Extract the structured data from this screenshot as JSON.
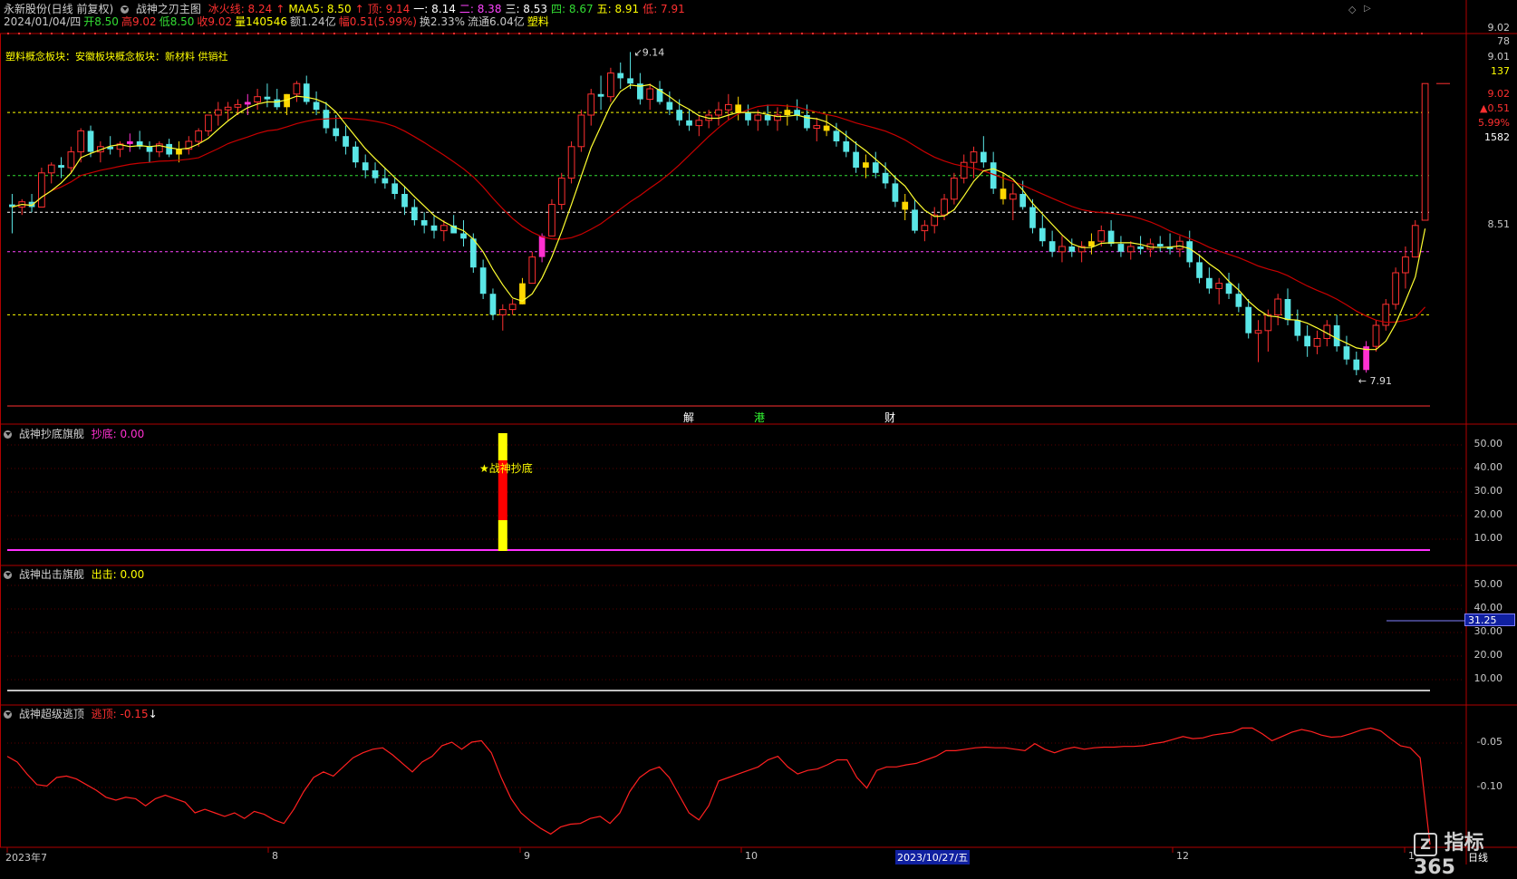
{
  "header": {
    "row1": {
      "stock": "永新股份(日线 前复权)",
      "indicator": "战神之刃主图",
      "items": [
        {
          "label": "冰火线: 8.24",
          "color": "#ff3030"
        },
        {
          "label": "↑",
          "color": "#ff3030"
        },
        {
          "label": "MAA5: 8.50",
          "color": "#ffff00"
        },
        {
          "label": "↑",
          "color": "#ff3030"
        },
        {
          "label": "顶: 9.14",
          "color": "#ff3030"
        },
        {
          "label": "一: 8.14",
          "color": "#ffffff"
        },
        {
          "label": "二: 8.38",
          "color": "#ff44ff"
        },
        {
          "label": "三: 8.53",
          "color": "#ffffff"
        },
        {
          "label": "四: 8.67",
          "color": "#33dd33"
        },
        {
          "label": "五: 8.91",
          "color": "#ffff00"
        },
        {
          "label": "低: 7.91",
          "color": "#ff3030"
        }
      ]
    },
    "row2": [
      {
        "label": "2024/01/04/四",
        "color": "#c8c8c8"
      },
      {
        "label": "开8.50",
        "color": "#33dd33"
      },
      {
        "label": "高9.02",
        "color": "#ff3030"
      },
      {
        "label": "低8.50",
        "color": "#33dd33"
      },
      {
        "label": "收9.02",
        "color": "#ff3030"
      },
      {
        "label": "量140546",
        "color": "#ffff00"
      },
      {
        "label": "额1.24亿",
        "color": "#c8c8c8"
      },
      {
        "label": "幅0.51(5.99%)",
        "color": "#ff3030"
      },
      {
        "label": "换2.33%",
        "color": "#c8c8c8"
      },
      {
        "label": "流通6.04亿",
        "color": "#c8c8c8"
      },
      {
        "label": "塑料",
        "color": "#ffff00"
      }
    ],
    "concept": "塑料概念板块：安徽板块概念板块：新材料 供销社"
  },
  "main_chart": {
    "price_axis": {
      "top": "9.02",
      "top2": "78",
      "p1": "9.01",
      "p1b": "137",
      "p2": "9.02",
      "p3": "▲0.51",
      "p4": "5.99%",
      "p5": "1582",
      "p6": "8.51"
    },
    "high_mark": "9.14",
    "low_mark": "7.91",
    "events": [
      "解",
      "港",
      "财"
    ],
    "ylim": [
      7.8,
      9.2
    ]
  },
  "panel1": {
    "title": "战神抄底旗舰",
    "value_label": "抄底: 0.00",
    "signal_text": "★战神抄底",
    "ticks": [
      "50.00",
      "40.00",
      "30.00",
      "20.00",
      "10.00"
    ]
  },
  "panel2": {
    "title": "战神出击旗舰",
    "value_label": "出击: 0.00",
    "cursor_value": "31.25",
    "ticks": [
      "50.00",
      "40.00",
      "30.00",
      "20.00",
      "10.00"
    ]
  },
  "panel3": {
    "title": "战神超级逃顶",
    "value_label": "逃顶: -0.15",
    "arrow": "↓",
    "ticks": [
      "-0.05",
      "-0.10"
    ],
    "ylim": [
      -0.2,
      0.0
    ],
    "values": [
      -0.07,
      -0.078,
      -0.095,
      -0.11,
      -0.112,
      -0.1,
      -0.098,
      -0.102,
      -0.11,
      -0.118,
      -0.128,
      -0.132,
      -0.128,
      -0.13,
      -0.14,
      -0.13,
      -0.125,
      -0.13,
      -0.135,
      -0.15,
      -0.145,
      -0.15,
      -0.155,
      -0.15,
      -0.158,
      -0.148,
      -0.152,
      -0.16,
      -0.165,
      -0.145,
      -0.12,
      -0.1,
      -0.092,
      -0.098,
      -0.085,
      -0.072,
      -0.065,
      -0.06,
      -0.058,
      -0.068,
      -0.08,
      -0.092,
      -0.078,
      -0.07,
      -0.055,
      -0.05,
      -0.06,
      -0.05,
      -0.048,
      -0.065,
      -0.1,
      -0.13,
      -0.15,
      -0.162,
      -0.172,
      -0.18,
      -0.17,
      -0.166,
      -0.165,
      -0.158,
      -0.155,
      -0.165,
      -0.15,
      -0.12,
      -0.1,
      -0.09,
      -0.085,
      -0.1,
      -0.125,
      -0.15,
      -0.16,
      -0.14,
      -0.105,
      -0.1,
      -0.095,
      -0.09,
      -0.085,
      -0.075,
      -0.07,
      -0.085,
      -0.095,
      -0.09,
      -0.088,
      -0.082,
      -0.075,
      -0.075,
      -0.1,
      -0.115,
      -0.09,
      -0.085,
      -0.085,
      -0.082,
      -0.08,
      -0.075,
      -0.07,
      -0.062,
      -0.062,
      -0.06,
      -0.058,
      -0.057,
      -0.058,
      -0.058,
      -0.06,
      -0.062,
      -0.052,
      -0.06,
      -0.065,
      -0.06,
      -0.057,
      -0.06,
      -0.058,
      -0.057,
      -0.057,
      -0.056,
      -0.056,
      -0.055,
      -0.052,
      -0.05,
      -0.046,
      -0.042,
      -0.045,
      -0.044,
      -0.04,
      -0.038,
      -0.036,
      -0.03,
      -0.03,
      -0.038,
      -0.048,
      -0.042,
      -0.036,
      -0.032,
      -0.035,
      -0.04,
      -0.043,
      -0.042,
      -0.038,
      -0.033,
      -0.03,
      -0.034,
      -0.045,
      -0.055,
      -0.058,
      -0.072,
      -0.195
    ]
  },
  "xaxis": {
    "labels": [
      "2023年7",
      "8",
      "9",
      "10",
      "2023/10/27/五",
      "12",
      "1"
    ],
    "right_label": "日线"
  },
  "watermark": {
    "text": "指标365",
    "logo": "Z"
  },
  "colors": {
    "up": "#ff3030",
    "down": "#5ae6e6",
    "yellowbar": "#ffd800",
    "magenta": "#ff30d0",
    "ma5": "#ffff30",
    "ma_long": "#c80000",
    "border": "#b00000"
  },
  "candles": [
    [
      8.56,
      8.6,
      8.45,
      8.55
    ],
    [
      8.55,
      8.58,
      8.52,
      8.57
    ],
    [
      8.57,
      8.6,
      8.53,
      8.55
    ],
    [
      8.55,
      8.7,
      8.55,
      8.68
    ],
    [
      8.68,
      8.72,
      8.64,
      8.71
    ],
    [
      8.71,
      8.74,
      8.66,
      8.7
    ],
    [
      8.7,
      8.78,
      8.68,
      8.76
    ],
    [
      8.76,
      8.85,
      8.72,
      8.84
    ],
    [
      8.84,
      8.86,
      8.74,
      8.76
    ],
    [
      8.76,
      8.8,
      8.72,
      8.78
    ],
    [
      8.78,
      8.82,
      8.75,
      8.77
    ],
    [
      8.77,
      8.8,
      8.74,
      8.79
    ],
    [
      8.79,
      8.83,
      8.76,
      8.8
    ],
    [
      8.8,
      8.84,
      8.77,
      8.78
    ],
    [
      8.78,
      8.8,
      8.72,
      8.76
    ],
    [
      8.76,
      8.8,
      8.74,
      8.79
    ],
    [
      8.79,
      8.81,
      8.74,
      8.75
    ],
    [
      8.75,
      8.8,
      8.72,
      8.77
    ],
    [
      8.77,
      8.82,
      8.75,
      8.8
    ],
    [
      8.8,
      8.85,
      8.78,
      8.84
    ],
    [
      8.84,
      8.9,
      8.82,
      8.9
    ],
    [
      8.9,
      8.95,
      8.86,
      8.92
    ],
    [
      8.92,
      8.95,
      8.88,
      8.93
    ],
    [
      8.93,
      8.96,
      8.9,
      8.94
    ],
    [
      8.94,
      8.98,
      8.9,
      8.95
    ],
    [
      8.95,
      9.0,
      8.92,
      8.97
    ],
    [
      8.97,
      9.02,
      8.93,
      8.96
    ],
    [
      8.96,
      9.0,
      8.92,
      8.93
    ],
    [
      8.93,
      8.98,
      8.9,
      8.98
    ],
    [
      8.98,
      9.03,
      8.95,
      9.02
    ],
    [
      9.02,
      9.05,
      8.94,
      8.95
    ],
    [
      8.95,
      8.99,
      8.9,
      8.92
    ],
    [
      8.92,
      8.95,
      8.83,
      8.85
    ],
    [
      8.85,
      8.9,
      8.8,
      8.82
    ],
    [
      8.82,
      8.86,
      8.75,
      8.78
    ],
    [
      8.78,
      8.8,
      8.7,
      8.72
    ],
    [
      8.72,
      8.75,
      8.66,
      8.69
    ],
    [
      8.69,
      8.72,
      8.64,
      8.66
    ],
    [
      8.66,
      8.7,
      8.62,
      8.64
    ],
    [
      8.64,
      8.66,
      8.58,
      8.6
    ],
    [
      8.6,
      8.63,
      8.52,
      8.55
    ],
    [
      8.55,
      8.58,
      8.48,
      8.5
    ],
    [
      8.5,
      8.53,
      8.45,
      8.48
    ],
    [
      8.48,
      8.52,
      8.43,
      8.46
    ],
    [
      8.46,
      8.5,
      8.42,
      8.48
    ],
    [
      8.48,
      8.52,
      8.45,
      8.45
    ],
    [
      8.45,
      8.5,
      8.4,
      8.43
    ],
    [
      8.43,
      8.45,
      8.3,
      8.32
    ],
    [
      8.32,
      8.35,
      8.2,
      8.22
    ],
    [
      8.22,
      8.24,
      8.12,
      8.14
    ],
    [
      8.14,
      8.18,
      8.08,
      8.16
    ],
    [
      8.16,
      8.2,
      8.14,
      8.18
    ],
    [
      8.18,
      8.28,
      8.18,
      8.26
    ],
    [
      8.26,
      8.38,
      8.26,
      8.36
    ],
    [
      8.36,
      8.45,
      8.34,
      8.44
    ],
    [
      8.44,
      8.58,
      8.44,
      8.56
    ],
    [
      8.56,
      8.68,
      8.54,
      8.66
    ],
    [
      8.66,
      8.8,
      8.64,
      8.78
    ],
    [
      8.78,
      8.92,
      8.76,
      8.9
    ],
    [
      8.9,
      9.0,
      8.86,
      8.98
    ],
    [
      8.98,
      9.05,
      8.92,
      8.97
    ],
    [
      8.97,
      9.08,
      8.95,
      9.06
    ],
    [
      9.06,
      9.1,
      9.0,
      9.04
    ],
    [
      9.04,
      9.14,
      9.0,
      9.02
    ],
    [
      9.02,
      9.06,
      8.94,
      8.96
    ],
    [
      8.96,
      9.02,
      8.92,
      9.0
    ],
    [
      9.0,
      9.03,
      8.94,
      8.95
    ],
    [
      8.95,
      8.99,
      8.9,
      8.92
    ],
    [
      8.92,
      8.96,
      8.86,
      8.88
    ],
    [
      8.88,
      8.92,
      8.84,
      8.86
    ],
    [
      8.86,
      8.9,
      8.82,
      8.88
    ],
    [
      8.88,
      8.92,
      8.85,
      8.9
    ],
    [
      8.9,
      8.95,
      8.86,
      8.92
    ],
    [
      8.92,
      8.98,
      8.88,
      8.94
    ],
    [
      8.94,
      8.97,
      8.88,
      8.91
    ],
    [
      8.91,
      8.94,
      8.86,
      8.88
    ],
    [
      8.88,
      8.92,
      8.84,
      8.9
    ],
    [
      8.9,
      8.94,
      8.86,
      8.88
    ],
    [
      8.88,
      8.93,
      8.84,
      8.9
    ],
    [
      8.9,
      8.94,
      8.86,
      8.92
    ],
    [
      8.92,
      8.96,
      8.88,
      8.9
    ],
    [
      8.9,
      8.94,
      8.84,
      8.85
    ],
    [
      8.85,
      8.89,
      8.8,
      8.86
    ],
    [
      8.86,
      8.9,
      8.82,
      8.84
    ],
    [
      8.84,
      8.87,
      8.78,
      8.8
    ],
    [
      8.8,
      8.84,
      8.74,
      8.76
    ],
    [
      8.76,
      8.8,
      8.68,
      8.7
    ],
    [
      8.7,
      8.75,
      8.66,
      8.72
    ],
    [
      8.72,
      8.76,
      8.66,
      8.68
    ],
    [
      8.68,
      8.72,
      8.62,
      8.64
    ],
    [
      8.64,
      8.67,
      8.55,
      8.57
    ],
    [
      8.57,
      8.6,
      8.5,
      8.54
    ],
    [
      8.54,
      8.58,
      8.45,
      8.46
    ],
    [
      8.46,
      8.5,
      8.42,
      8.48
    ],
    [
      8.48,
      8.55,
      8.45,
      8.52
    ],
    [
      8.52,
      8.6,
      8.5,
      8.58
    ],
    [
      8.58,
      8.68,
      8.56,
      8.66
    ],
    [
      8.66,
      8.75,
      8.64,
      8.72
    ],
    [
      8.72,
      8.78,
      8.66,
      8.76
    ],
    [
      8.76,
      8.82,
      8.7,
      8.72
    ],
    [
      8.72,
      8.76,
      8.6,
      8.62
    ],
    [
      8.62,
      8.68,
      8.56,
      8.58
    ],
    [
      8.58,
      8.64,
      8.5,
      8.6
    ],
    [
      8.6,
      8.65,
      8.54,
      8.55
    ],
    [
      8.55,
      8.58,
      8.45,
      8.47
    ],
    [
      8.47,
      8.52,
      8.4,
      8.42
    ],
    [
      8.42,
      8.46,
      8.36,
      8.38
    ],
    [
      8.38,
      8.44,
      8.34,
      8.4
    ],
    [
      8.4,
      8.43,
      8.36,
      8.38
    ],
    [
      8.38,
      8.42,
      8.34,
      8.4
    ],
    [
      8.4,
      8.45,
      8.37,
      8.42
    ],
    [
      8.42,
      8.48,
      8.4,
      8.46
    ],
    [
      8.46,
      8.5,
      8.4,
      8.41
    ],
    [
      8.41,
      8.44,
      8.36,
      8.38
    ],
    [
      8.38,
      8.42,
      8.35,
      8.4
    ],
    [
      8.4,
      8.44,
      8.37,
      8.39
    ],
    [
      8.39,
      8.43,
      8.36,
      8.41
    ],
    [
      8.41,
      8.44,
      8.38,
      8.4
    ],
    [
      8.4,
      8.45,
      8.37,
      8.39
    ],
    [
      8.39,
      8.44,
      8.36,
      8.42
    ],
    [
      8.42,
      8.46,
      8.32,
      8.34
    ],
    [
      8.34,
      8.37,
      8.26,
      8.28
    ],
    [
      8.28,
      8.32,
      8.22,
      8.24
    ],
    [
      8.24,
      8.28,
      8.18,
      8.26
    ],
    [
      8.26,
      8.3,
      8.2,
      8.22
    ],
    [
      8.22,
      8.26,
      8.15,
      8.17
    ],
    [
      8.17,
      8.2,
      8.05,
      8.07
    ],
    [
      8.07,
      8.12,
      7.96,
      8.08
    ],
    [
      8.08,
      8.16,
      8.0,
      8.14
    ],
    [
      8.14,
      8.22,
      8.1,
      8.2
    ],
    [
      8.2,
      8.24,
      8.1,
      8.12
    ],
    [
      8.12,
      8.16,
      8.04,
      8.06
    ],
    [
      8.06,
      8.1,
      7.98,
      8.02
    ],
    [
      8.02,
      8.08,
      7.99,
      8.05
    ],
    [
      8.05,
      8.12,
      8.02,
      8.1
    ],
    [
      8.1,
      8.14,
      8.0,
      8.02
    ],
    [
      8.02,
      8.06,
      7.95,
      7.97
    ],
    [
      7.97,
      8.0,
      7.91,
      7.93
    ],
    [
      7.93,
      8.04,
      7.92,
      8.02
    ],
    [
      8.02,
      8.12,
      8.0,
      8.1
    ],
    [
      8.1,
      8.2,
      8.08,
      8.18
    ],
    [
      8.18,
      8.32,
      8.16,
      8.3
    ],
    [
      8.3,
      8.4,
      8.24,
      8.36
    ],
    [
      8.36,
      8.5,
      8.36,
      8.48
    ],
    [
      8.5,
      9.02,
      8.5,
      9.02
    ]
  ],
  "candle_colors": {
    "12": "magenta",
    "17": "yellow",
    "24": "magenta",
    "28": "yellow",
    "52": "yellow",
    "54": "magenta",
    "74": "yellow",
    "79": "yellow",
    "83": "yellow",
    "87": "yellow",
    "91": "yellow",
    "101": "yellow",
    "110": "yellow",
    "138": "magenta"
  }
}
